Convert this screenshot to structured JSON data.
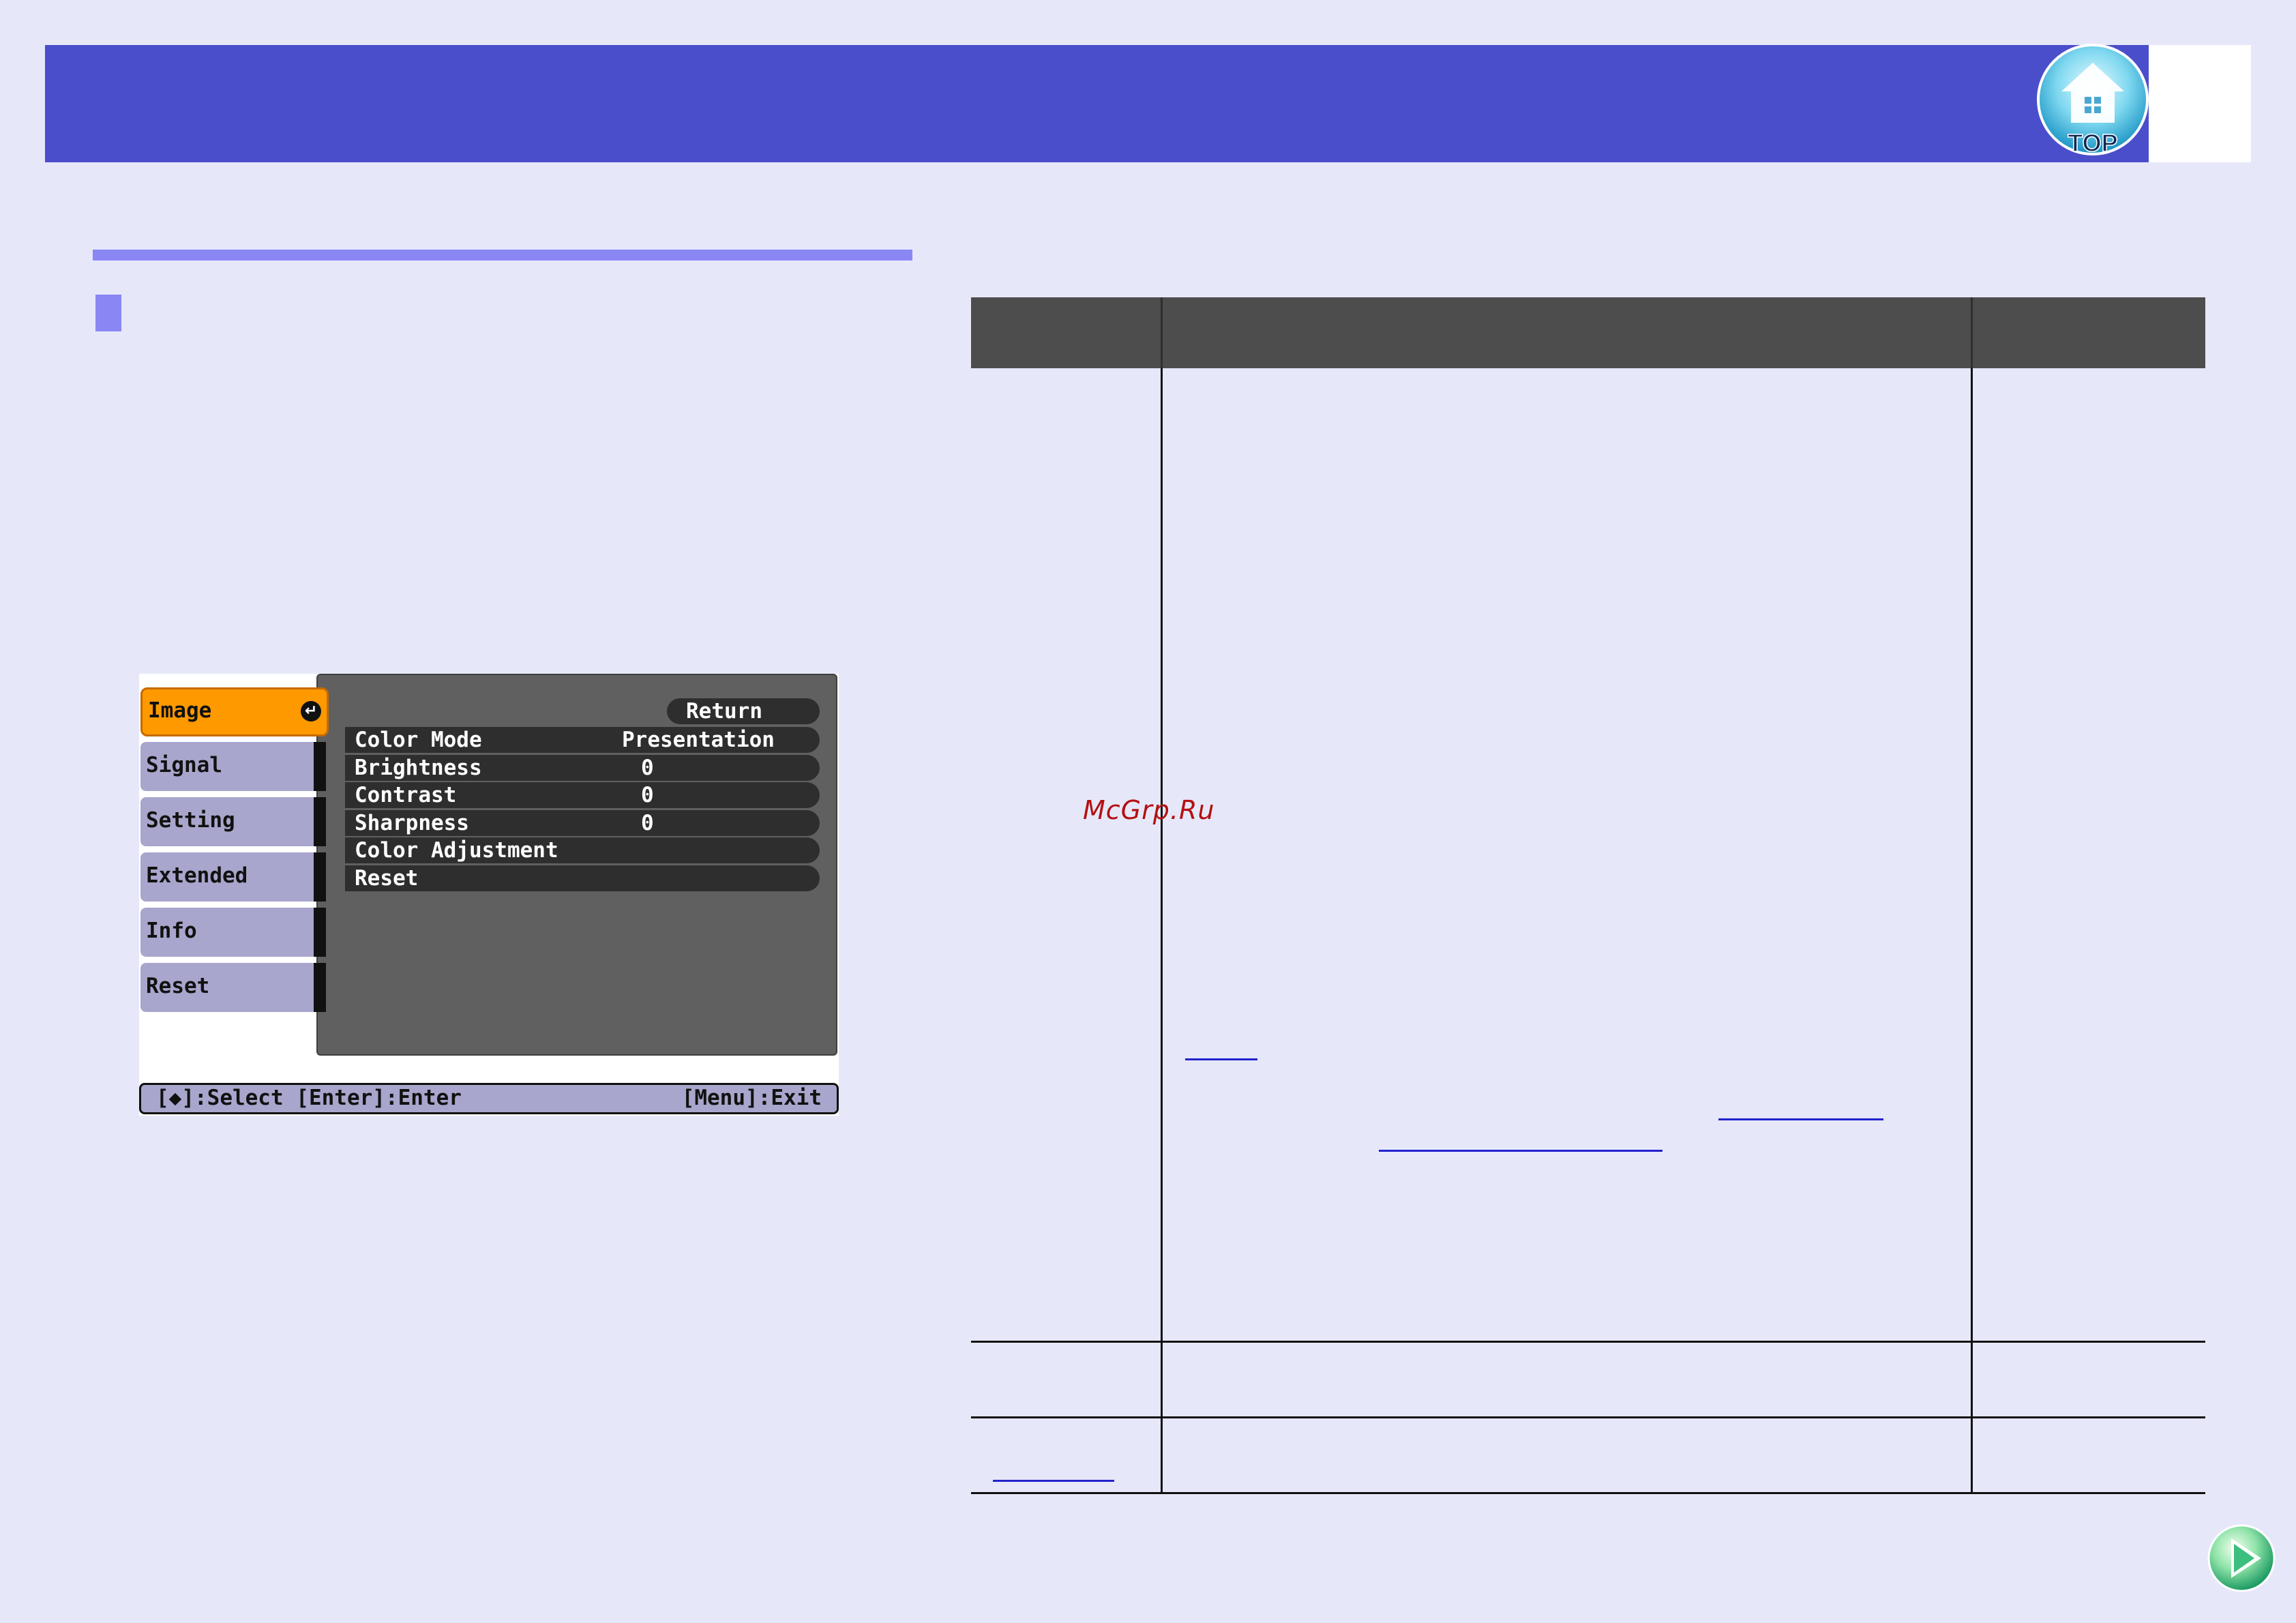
{
  "header": {
    "top_button_label": "TOP"
  },
  "projector_menu": {
    "tabs": [
      {
        "label": "Image",
        "active": true
      },
      {
        "label": "Signal",
        "active": false
      },
      {
        "label": "Setting",
        "active": false
      },
      {
        "label": "Extended",
        "active": false
      },
      {
        "label": "Info",
        "active": false
      },
      {
        "label": "Reset",
        "active": false
      }
    ],
    "return_label": "Return",
    "rows": [
      {
        "label": "Color Mode",
        "value": "Presentation"
      },
      {
        "label": "Brightness",
        "value": "0"
      },
      {
        "label": "Contrast",
        "value": "0"
      },
      {
        "label": "Sharpness",
        "value": "0"
      },
      {
        "label": "Color Adjustment",
        "value": ""
      },
      {
        "label": "Reset",
        "value": ""
      }
    ],
    "help_left": "[◆]:Select [Enter]:Enter",
    "help_right": "[Menu]:Exit"
  },
  "watermark": "McGrp.Ru",
  "colors": {
    "page_bg": "#e6e8fa",
    "header": "#4b4ecb",
    "accent": "#8a87f5",
    "active_tab": "#ff9900",
    "table_header": "#4d4d4d"
  }
}
